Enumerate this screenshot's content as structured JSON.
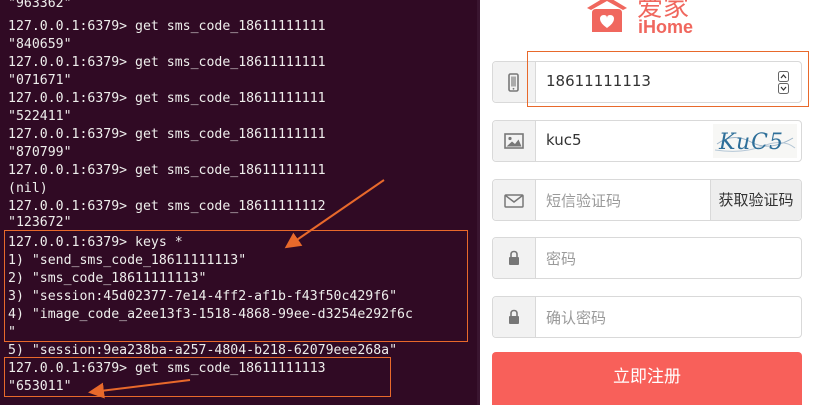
{
  "terminal": {
    "lines": [
      "\"963362\"",
      "127.0.0.1:6379> get sms_code_18611111111",
      "\"840659\"",
      "127.0.0.1:6379> get sms_code_18611111111",
      "\"071671\"",
      "127.0.0.1:6379> get sms_code_18611111111",
      "\"522411\"",
      "127.0.0.1:6379> get sms_code_18611111111",
      "\"870799\"",
      "127.0.0.1:6379> get sms_code_18611111111",
      "(nil)",
      "127.0.0.1:6379> get sms_code_18611111112",
      "\"123672\"",
      "127.0.0.1:6379> keys *",
      "1) \"send_sms_code_18611111113\"",
      "2) \"sms_code_18611111113\"",
      "3) \"session:45d02377-7e14-4ff2-af1b-f43f50c429f6\"",
      "4) \"image_code_a2ee13f3-1518-4868-99ee-d3254e292f6c",
      "\"",
      "5) \"session:9ea238ba-a257-4804-b218-62079eee268a\"",
      "127.0.0.1:6379> get sms_code_18611111113",
      "\"653011\""
    ]
  },
  "logo": {
    "cn": "爱家",
    "en": "iHome"
  },
  "form": {
    "phone_value": "18611111113",
    "image_code_value": "kuc5",
    "captcha_text": "KuC5",
    "sms_placeholder": "短信验证码",
    "sms_button": "获取验证码",
    "password_placeholder": "密码",
    "confirm_placeholder": "确认密码",
    "submit_label": "立即注册"
  },
  "colors": {
    "terminal_bg": "#300a24",
    "accent": "#f8605a",
    "annotation": "#e8692b"
  }
}
